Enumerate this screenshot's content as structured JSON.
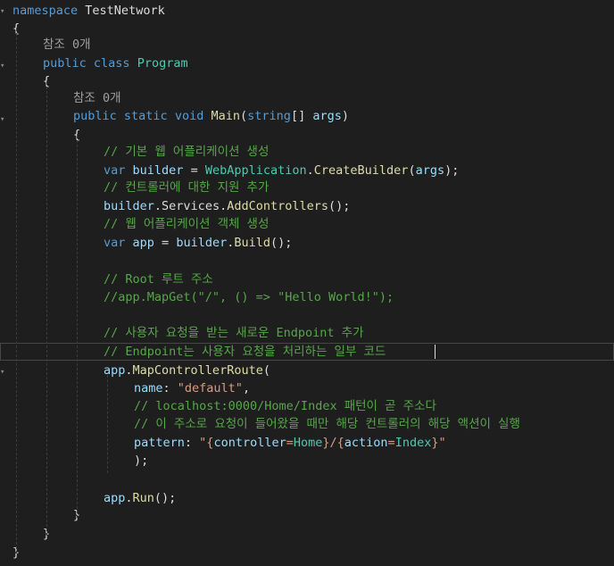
{
  "editor": {
    "colors": {
      "background": "#1e1e1e",
      "keyword": "#569cd6",
      "type": "#4ec9b0",
      "method": "#dcdcaa",
      "string": "#d69d85",
      "comment": "#57a64a",
      "parameter": "#9cdcfe",
      "plain": "#dcdcdc",
      "codelens": "#a0a0a0"
    },
    "lines": [
      {
        "tokens": [
          {
            "t": "namespace",
            "c": "kw"
          },
          {
            "t": " "
          },
          {
            "t": "TestNetwork",
            "c": "pn"
          }
        ]
      },
      {
        "tokens": [
          {
            "t": "{"
          }
        ]
      },
      {
        "tokens": [
          {
            "t": "참조 0개",
            "c": "lens"
          }
        ]
      },
      {
        "tokens": [
          {
            "t": "public",
            "c": "kw"
          },
          {
            "t": " "
          },
          {
            "t": "class",
            "c": "kw"
          },
          {
            "t": " "
          },
          {
            "t": "Program",
            "c": "ty"
          }
        ]
      },
      {
        "tokens": [
          {
            "t": "{"
          }
        ]
      },
      {
        "tokens": [
          {
            "t": "참조 0개",
            "c": "lens"
          }
        ]
      },
      {
        "tokens": [
          {
            "t": "public",
            "c": "kw"
          },
          {
            "t": " "
          },
          {
            "t": "static",
            "c": "kw"
          },
          {
            "t": " "
          },
          {
            "t": "void",
            "c": "kw"
          },
          {
            "t": " "
          },
          {
            "t": "Main",
            "c": "mt"
          },
          {
            "t": "("
          },
          {
            "t": "string",
            "c": "kw"
          },
          {
            "t": "[] "
          },
          {
            "t": "args",
            "c": "pr"
          },
          {
            "t": ")"
          }
        ]
      },
      {
        "tokens": [
          {
            "t": "{"
          }
        ]
      },
      {
        "tokens": [
          {
            "t": "// 기본 웹 어플리케이션 생성",
            "c": "cm"
          }
        ]
      },
      {
        "tokens": [
          {
            "t": "var",
            "c": "kw"
          },
          {
            "t": " "
          },
          {
            "t": "builder",
            "c": "pr"
          },
          {
            "t": " = "
          },
          {
            "t": "WebApplication",
            "c": "ty"
          },
          {
            "t": "."
          },
          {
            "t": "CreateBuilder",
            "c": "mt"
          },
          {
            "t": "("
          },
          {
            "t": "args",
            "c": "pr"
          },
          {
            "t": ");"
          }
        ]
      },
      {
        "tokens": [
          {
            "t": "// 컨트롤러에 대한 지원 추가",
            "c": "cm"
          }
        ]
      },
      {
        "tokens": [
          {
            "t": "builder",
            "c": "pr"
          },
          {
            "t": "."
          },
          {
            "t": "Services",
            "c": "pn"
          },
          {
            "t": "."
          },
          {
            "t": "AddControllers",
            "c": "mt"
          },
          {
            "t": "();"
          }
        ]
      },
      {
        "tokens": [
          {
            "t": "// 웹 어플리케이션 객체 생성",
            "c": "cm"
          }
        ]
      },
      {
        "tokens": [
          {
            "t": "var",
            "c": "kw"
          },
          {
            "t": " "
          },
          {
            "t": "app",
            "c": "pr"
          },
          {
            "t": " = "
          },
          {
            "t": "builder",
            "c": "pr"
          },
          {
            "t": "."
          },
          {
            "t": "Build",
            "c": "mt"
          },
          {
            "t": "();"
          }
        ]
      },
      {
        "tokens": []
      },
      {
        "tokens": [
          {
            "t": "// Root 루트 주소",
            "c": "cm"
          }
        ]
      },
      {
        "tokens": [
          {
            "t": "//app.MapGet(\"/\", () => \"Hello World!\");",
            "c": "cm"
          }
        ]
      },
      {
        "tokens": []
      },
      {
        "tokens": [
          {
            "t": "// 사용자 요청을 받는 새로운 Endpoint 추가",
            "c": "cm"
          }
        ]
      },
      {
        "tokens": [
          {
            "t": "// Endpoint는 사용자 요청을 처리하는 일부 코드",
            "c": "cm"
          }
        ]
      },
      {
        "tokens": [
          {
            "t": "app",
            "c": "pr"
          },
          {
            "t": "."
          },
          {
            "t": "MapControllerRoute",
            "c": "mt"
          },
          {
            "t": "("
          }
        ]
      },
      {
        "tokens": [
          {
            "t": "name",
            "c": "pr"
          },
          {
            "t": ": "
          },
          {
            "t": "\"default\"",
            "c": "st"
          },
          {
            "t": ","
          }
        ]
      },
      {
        "tokens": [
          {
            "t": "// localhost:0000/Home/Index 패턴이 곧 주소다",
            "c": "cm"
          }
        ]
      },
      {
        "tokens": [
          {
            "t": "// 이 주소로 요청이 들어왔을 때만 해당 컨트롤러의 해당 액션이 실행",
            "c": "cm"
          }
        ]
      },
      {
        "tokens": [
          {
            "t": "pattern",
            "c": "pr"
          },
          {
            "t": ": "
          },
          {
            "t": "\"{",
            "c": "st"
          },
          {
            "t": "controller",
            "c": "pr"
          },
          {
            "t": "=",
            "c": "st"
          },
          {
            "t": "Home",
            "c": "ty"
          },
          {
            "t": "}/{",
            "c": "st"
          },
          {
            "t": "action",
            "c": "pr"
          },
          {
            "t": "=",
            "c": "st"
          },
          {
            "t": "Index",
            "c": "ty"
          },
          {
            "t": "}\"",
            "c": "st"
          }
        ]
      },
      {
        "tokens": [
          {
            "t": ");"
          }
        ]
      },
      {
        "tokens": []
      },
      {
        "tokens": [
          {
            "t": "app",
            "c": "pr"
          },
          {
            "t": "."
          },
          {
            "t": "Run",
            "c": "mt"
          },
          {
            "t": "();"
          }
        ]
      },
      {
        "tokens": [
          {
            "t": "}"
          }
        ]
      },
      {
        "tokens": [
          {
            "t": "}"
          }
        ]
      },
      {
        "tokens": [
          {
            "t": "}"
          }
        ]
      }
    ]
  }
}
